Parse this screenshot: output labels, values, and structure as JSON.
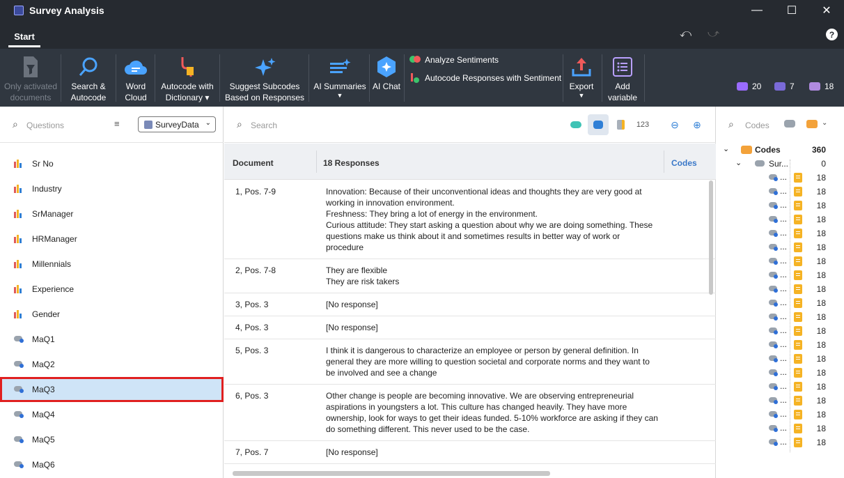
{
  "window": {
    "title": "Survey Analysis",
    "minimize": "—",
    "maximize": "☐",
    "close": "✕"
  },
  "tabs": {
    "start": "Start"
  },
  "ribbon": {
    "only_activated": [
      "Only activated",
      "documents"
    ],
    "search_autocode": [
      "Search &",
      "Autocode"
    ],
    "word_cloud": [
      "Word",
      "Cloud"
    ],
    "autocode_dictionary": [
      "Autocode with",
      "Dictionary ▾"
    ],
    "suggest_subcodes": [
      "Suggest Subcodes",
      "Based on Responses"
    ],
    "ai_summaries": [
      "AI Summaries"
    ],
    "ai_chat": [
      "AI Chat"
    ],
    "analyze_sentiments": "Analyze Sentiments",
    "autocode_sentiment": "Autocode Responses with Sentiment",
    "export": [
      "Export"
    ],
    "add_variable": [
      "Add",
      "variable"
    ],
    "stats": [
      {
        "name": "codes-count",
        "value": "20"
      },
      {
        "name": "memos-count",
        "value": "7"
      },
      {
        "name": "docs-count",
        "value": "18"
      }
    ]
  },
  "left": {
    "search_placeholder": "Questions",
    "dataset": "SurveyData",
    "variables": [
      {
        "label": "Sr No",
        "type": "bar"
      },
      {
        "label": "Industry",
        "type": "bar"
      },
      {
        "label": "SrManager",
        "type": "bar"
      },
      {
        "label": "HRManager",
        "type": "bar"
      },
      {
        "label": "Millennials",
        "type": "bar"
      },
      {
        "label": "Experience",
        "type": "bar"
      },
      {
        "label": "Gender",
        "type": "bar"
      },
      {
        "label": "MaQ1",
        "type": "tag"
      },
      {
        "label": "MaQ2",
        "type": "tag"
      },
      {
        "label": "MaQ3",
        "type": "tag",
        "selected": true
      },
      {
        "label": "MaQ4",
        "type": "tag"
      },
      {
        "label": "MaQ5",
        "type": "tag"
      },
      {
        "label": "MaQ6",
        "type": "tag"
      }
    ]
  },
  "middle": {
    "search_placeholder": "Search",
    "numeric_toggle": "123",
    "header": {
      "document": "Document",
      "responses": "18 Responses",
      "codes": "Codes"
    },
    "rows": [
      {
        "doc": "1, Pos. 7-9",
        "lines": [
          "Innovation: Because of their unconventional ideas and thoughts they are very good at",
          "working in innovation environment.",
          "Freshness:  They bring a lot of energy in the environment.",
          "Curious attitude: They start asking a question about why we are doing something. These",
          "questions make us think about it and sometimes results in better way of work or",
          "procedure"
        ]
      },
      {
        "doc": "2, Pos. 7-8",
        "lines": [
          "They are flexible",
          "They are risk takers"
        ]
      },
      {
        "doc": "3, Pos. 3",
        "lines": [
          "[No response]"
        ]
      },
      {
        "doc": "4, Pos. 3",
        "lines": [
          "[No response]"
        ]
      },
      {
        "doc": "5, Pos. 3",
        "lines": [
          "I think it is dangerous to characterize an employee or person by general definition. In",
          "general they are more willing to question societal and corporate  norms and they want to",
          "be involved and see a change"
        ]
      },
      {
        "doc": "6, Pos. 3",
        "lines": [
          "Other change is people are becoming innovative. We are observing entrepreneurial",
          "aspirations in youngsters a lot. This culture has changed heavily. They have more",
          "ownership, look for ways to get their ideas funded. 5-10% workforce are asking if they can",
          "do something different. This never used to be the case."
        ]
      },
      {
        "doc": "7, Pos. 7",
        "lines": [
          "[No response]"
        ]
      }
    ]
  },
  "right": {
    "search_placeholder": "Codes",
    "root": {
      "label": "Codes",
      "count": "360"
    },
    "child": {
      "label": "Sur...",
      "count": "0"
    },
    "subcodes": [
      {
        "label": "...",
        "count": "18"
      },
      {
        "label": "...",
        "count": "18"
      },
      {
        "label": "...",
        "count": "18"
      },
      {
        "label": "...",
        "count": "18"
      },
      {
        "label": "...",
        "count": "18"
      },
      {
        "label": "...",
        "count": "18"
      },
      {
        "label": "...",
        "count": "18"
      },
      {
        "label": "...",
        "count": "18"
      },
      {
        "label": "...",
        "count": "18"
      },
      {
        "label": "...",
        "count": "18"
      },
      {
        "label": "...",
        "count": "18"
      },
      {
        "label": "...",
        "count": "18"
      },
      {
        "label": "...",
        "count": "18"
      },
      {
        "label": "...",
        "count": "18"
      },
      {
        "label": "...",
        "count": "18"
      },
      {
        "label": "...",
        "count": "18"
      },
      {
        "label": "...",
        "count": "18"
      },
      {
        "label": "...",
        "count": "18"
      },
      {
        "label": "...",
        "count": "18"
      },
      {
        "label": "...",
        "count": "18"
      }
    ]
  },
  "colors": {
    "titlebar": "#262a30",
    "ribbon": "#303740",
    "selected_row": "#cfe4f7",
    "highlight_border": "#e02020",
    "accent_blue": "#3a78c8",
    "memo_orange": "#f5b324"
  }
}
